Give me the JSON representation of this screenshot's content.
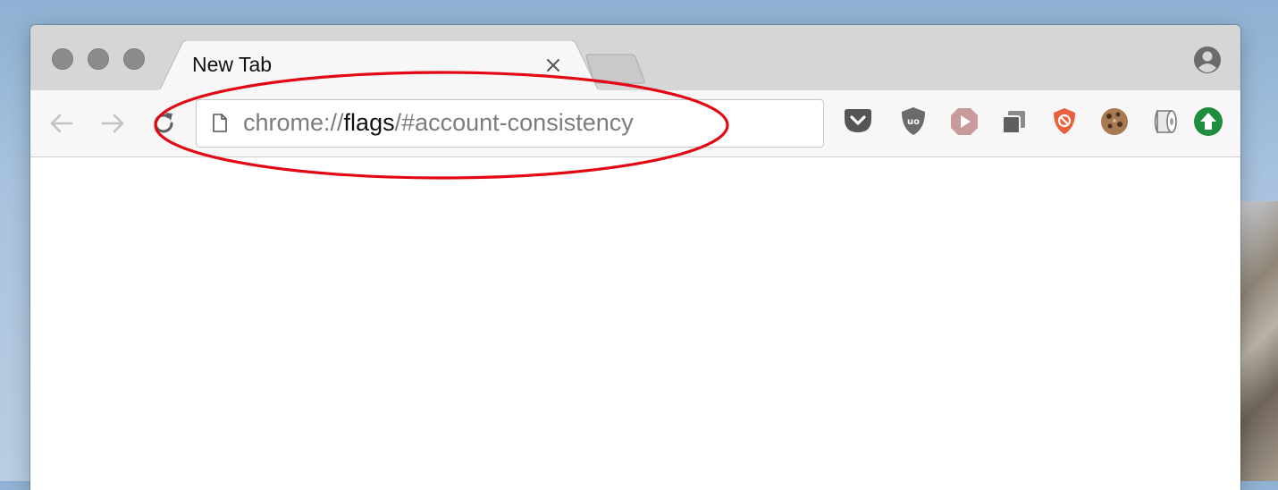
{
  "tab": {
    "title": "New Tab",
    "close_label": "×"
  },
  "omnibox": {
    "scheme": "chrome://",
    "host": "flags",
    "path": "/#account-consistency"
  },
  "extensions": [
    "pocket-icon",
    "ublock-origin-icon",
    "video-play-icon",
    "copy-windows-icon",
    "adblock-shield-icon",
    "cookie-icon",
    "toilet-paper-icon",
    "update-arrow-icon"
  ],
  "colors": {
    "annotation": "#e30613",
    "update_badge": "#1e8e3e",
    "adblock": "#e8603c"
  }
}
